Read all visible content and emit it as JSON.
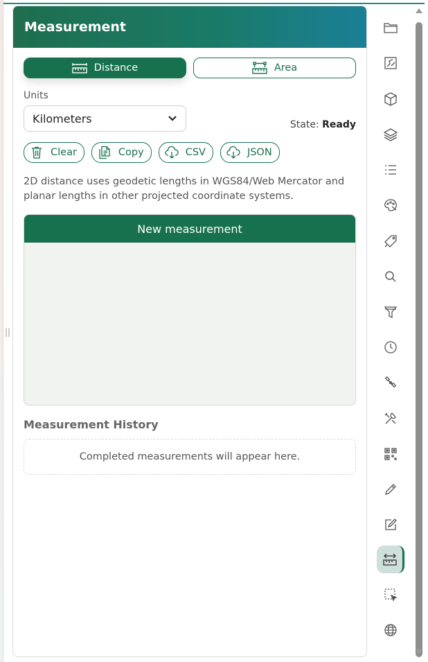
{
  "panel": {
    "title": "Measurement"
  },
  "modes": {
    "distance_label": "Distance",
    "area_label": "Area",
    "active": "distance"
  },
  "units": {
    "label": "Units",
    "selected": "Kilometers"
  },
  "state": {
    "label": "State:",
    "value": "Ready"
  },
  "actions": {
    "clear": "Clear",
    "copy": "Copy",
    "csv": "CSV",
    "json": "JSON"
  },
  "description": "2D distance uses geodetic lengths in WGS84/Web Mercator and planar lengths in other projected coordinate systems.",
  "measurement": {
    "header": "New measurement"
  },
  "history": {
    "title": "Measurement History",
    "empty_text": "Completed measurements will appear here."
  },
  "toolbar": {
    "items": [
      {
        "icon": "folder-icon"
      },
      {
        "icon": "map-edit-icon"
      },
      {
        "icon": "cube-icon"
      },
      {
        "icon": "layers-icon"
      },
      {
        "icon": "list-icon"
      },
      {
        "icon": "palette-icon"
      },
      {
        "icon": "tag-icon"
      },
      {
        "icon": "search-icon"
      },
      {
        "icon": "filter-icon"
      },
      {
        "icon": "clock-icon"
      },
      {
        "icon": "satellite-icon"
      },
      {
        "icon": "tools-icon"
      },
      {
        "icon": "qr-code-icon"
      },
      {
        "icon": "pencil-icon"
      },
      {
        "icon": "edit-note-icon"
      },
      {
        "icon": "measure-ruler-icon",
        "active": true
      },
      {
        "icon": "selection-icon"
      },
      {
        "icon": "globe-icon"
      }
    ]
  },
  "colors": {
    "accent": "#17714f",
    "header_gradient_start": "#1f6e4f",
    "header_gradient_end": "#1b7f96"
  }
}
